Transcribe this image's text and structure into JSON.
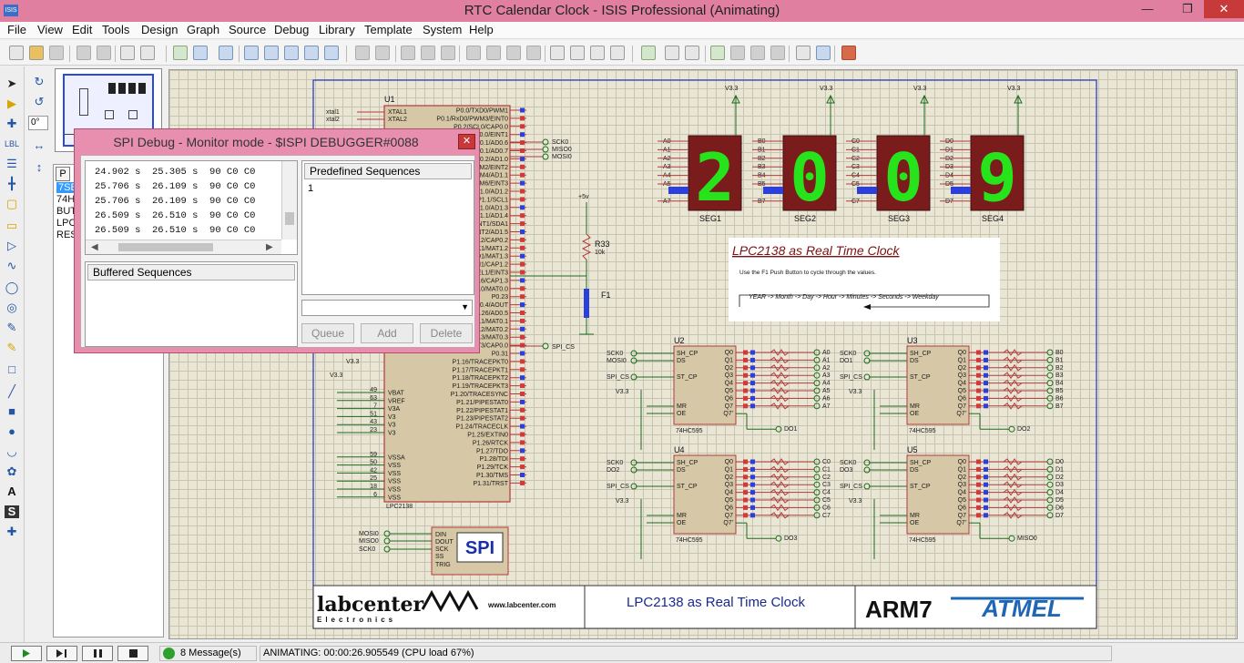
{
  "window": {
    "title": "RTC Calendar Clock - ISIS Professional (Animating)",
    "logo": "ISIS"
  },
  "menu": [
    "File",
    "View",
    "Edit",
    "Tools",
    "Design",
    "Graph",
    "Source",
    "Debug",
    "Library",
    "Template",
    "System",
    "Help"
  ],
  "overview": {
    "label": "schematic overview"
  },
  "device_panel": {
    "tab": "P",
    "items": [
      "7SE",
      "74H",
      "BUT",
      "LPC",
      "RES"
    ]
  },
  "rotation": {
    "angle": "0°"
  },
  "spi": {
    "title": "SPI Debug - Monitor mode - $ISPI DEBUGGER#0088",
    "log": [
      "24.902 s  25.305 s  90 C0 C0",
      "25.706 s  26.109 s  90 C0 C0",
      "25.706 s  26.109 s  90 C0 C0",
      "26.509 s  26.510 s  90 C0 C0",
      "26.509 s  26.510 s  90 C0 C0"
    ],
    "predefined_label": "Predefined Sequences",
    "predefined_items": [
      "1"
    ],
    "buffered_label": "Buffered Sequences",
    "queue": "Queue",
    "add": "Add",
    "delete": "Delete"
  },
  "schematic": {
    "chip_u1": "U1",
    "chip_u1_name": "LPC2138",
    "u1_left_pins": [
      "xtal1",
      "xtal2"
    ],
    "u1_left_inner": [
      "XTAL1",
      "XTAL2"
    ],
    "u1_right_pins": [
      "P0.0/TXD0/PWM1",
      "P0.1/RxD0/PWM3/EINT0",
      "P0.2/SCL0/CAP0.0",
      "P0.3/SDA0/MAT0.0/EINT1",
      "P0.4/SCK0/CAP0.1/AD0.6",
      "P0.5/MISO0/MAT0.1/AD0.7",
      "P0.6/MOSI0/CAP0.2/AD1.0",
      "P0.7/SSEL0/PWM2/EINT2",
      "P0.8/TXD1/PWM4/AD1.1",
      "P0.9/RXD1/PWM6/EINT3",
      "P0.10/RTS1/CAP1.0/AD1.2",
      "P0.11/CTS1/CAP1.1/SCL1",
      "P0.12/DSR1/MAT1.0/AD1.3",
      "P0.13/DTR1/MAT1.1/AD1.4",
      "P0.14/DCD1/EINT1/SDA1",
      "P0.15/RI1/EINT2/AD1.5",
      "P0.16/EINT0/MAT0.2/CAP0.2",
      "P0.17/CAP1.2/SCK1/MAT1.2",
      "P0.18/CAP1.3/MISO1/MAT1.3",
      "P0.19/MAT1.2/MOSI1/CAP1.2",
      "P0.20/MAT1.3/SSEL1/EINT3",
      "P0.21/PWM5/AD1.6/CAP1.3",
      "P0.22/AD1.7/CAP0.0/MAT0.0",
      "P0.23",
      "P0.25/AD0.4/AOUT",
      "P0.26/AD0.5",
      "P0.27/AD0.0/CAP0.1/MAT0.1",
      "P0.28/AD0.1/CAP0.2/MAT0.2",
      "P0.29/AD0.2/CAP0.3/MAT0.3",
      "P0.30/AD0.3/EINT3/CAP0.0",
      "P0.31",
      "P1.16/TRACEPKT0",
      "P1.17/TRACEPKT1",
      "P1.18/TRACEPKT2",
      "P1.19/TRACEPKT3",
      "P1.20/TRACESYNC",
      "P1.21/PIPESTAT0",
      "P1.22/PIPESTAT1",
      "P1.23/PIPESTAT2",
      "P1.24/TRACECLK",
      "P1.25/EXTIN0",
      "P1.26/RTCK",
      "P1.27/TDO",
      "P1.28/TDI",
      "P1.29/TCK",
      "P1.30/TMS",
      "P1.31/TRST"
    ],
    "u1_power_pins": [
      "VBAT",
      "VREF",
      "V3A",
      "V3",
      "V3",
      "V3",
      "VSSA",
      "VSS",
      "VSS",
      "VSS",
      "VSS",
      "VSS"
    ],
    "u1_power_nums": [
      "49",
      "63",
      "7",
      "51",
      "43",
      "23",
      "59",
      "50",
      "42",
      "25",
      "18",
      "6"
    ],
    "net_sck": "SCK0",
    "net_miso": "MISO0",
    "net_mosi": "MOSI0",
    "net_spics": "SPI_CS",
    "power": "+5v",
    "v33": "V3.3",
    "r33": "R33",
    "r33_val": "10k",
    "f1": "F1",
    "seg_labels": [
      "SEG1",
      "SEG2",
      "SEG3",
      "SEG4"
    ],
    "seg_digits": [
      "2",
      "0",
      "0",
      "9"
    ],
    "seg_pin_groups": [
      [
        "A0",
        "A1",
        "A2",
        "A3",
        "A4",
        "A5",
        "A6",
        "A7"
      ],
      [
        "B0",
        "B1",
        "B2",
        "B3",
        "B4",
        "B5",
        "B6",
        "B7"
      ],
      [
        "C0",
        "C1",
        "C2",
        "C3",
        "C4",
        "C5",
        "C6",
        "C7"
      ],
      [
        "D0",
        "D1",
        "D2",
        "D3",
        "D4",
        "D5",
        "D6",
        "D7"
      ]
    ],
    "panel_title": "LPC2138 as Real Time Clock",
    "panel_text": "Use the F1 Push Button to cycle through the values.",
    "panel_cycle": "YEAR -> Month -> Day -> Hour -> Minutes -> Seconds -> Weekday",
    "shift_regs": [
      {
        "id": "U2",
        "name": "74HC595",
        "in1": "SCK0",
        "in2": "MOSI0",
        "in3": "SPI_CS",
        "out": "DO1",
        "outs": [
          "A0",
          "A1",
          "A2",
          "A3",
          "A4",
          "A5",
          "A6",
          "A7"
        ]
      },
      {
        "id": "U3",
        "name": "74HC595",
        "in1": "SCK0",
        "in2": "DO1",
        "in3": "SPI_CS",
        "out": "DO2",
        "outs": [
          "B0",
          "B1",
          "B2",
          "B3",
          "B4",
          "B5",
          "B6",
          "B7"
        ]
      },
      {
        "id": "U4",
        "name": "74HC595",
        "in1": "SCK0",
        "in2": "DO2",
        "in3": "SPI_CS",
        "out": "DO3",
        "outs": [
          "C0",
          "C1",
          "C2",
          "C3",
          "C4",
          "C5",
          "C6",
          "C7"
        ]
      },
      {
        "id": "U5",
        "name": "74HC595",
        "in1": "SCK0",
        "in2": "DO3",
        "in3": "SPI_CS",
        "out": "MISO0",
        "outs": [
          "D0",
          "D1",
          "D2",
          "D3",
          "D4",
          "D5",
          "D6",
          "D7"
        ]
      }
    ],
    "sr_pins_left": [
      "SH_CP",
      "DS",
      "ST_CP",
      "MR",
      "OE"
    ],
    "sr_pins_right": [
      "Q0",
      "Q1",
      "Q2",
      "Q3",
      "Q4",
      "Q5",
      "Q6",
      "Q7",
      "Q7'"
    ],
    "spi_box": {
      "label": "SPI",
      "pins": [
        "DIN",
        "DOUT",
        "SCK",
        "SS",
        "TRIG"
      ],
      "nets": [
        "MOSI0",
        "MISO0",
        "SCK0"
      ]
    },
    "footer_brand": "labcenter",
    "footer_url": "www.labcenter.com",
    "footer_sub": "Electronics",
    "footer_title": "LPC2138 as Real Time Clock",
    "footer_arm": "ARM7",
    "footer_atmel": "ATMEL"
  },
  "status": {
    "messages": "8 Message(s)",
    "animating": "ANIMATING: 00:00:26.905549 (CPU load 67%)"
  }
}
